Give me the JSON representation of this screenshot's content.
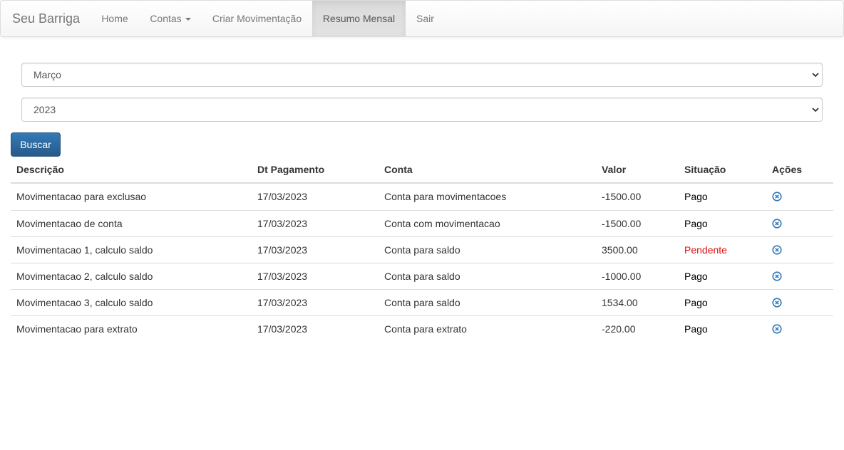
{
  "navbar": {
    "brand": "Seu Barriga",
    "items": [
      {
        "label": "Home"
      },
      {
        "label": "Contas"
      },
      {
        "label": "Criar Movimentação"
      },
      {
        "label": "Resumo Mensal"
      },
      {
        "label": "Sair"
      }
    ],
    "active_item": "Resumo Mensal"
  },
  "filters": {
    "month_selected": "Março",
    "year_selected": "2023",
    "search_label": "Buscar"
  },
  "table": {
    "headers": [
      "Descrição",
      "Dt Pagamento",
      "Conta",
      "Valor",
      "Situação",
      "Ações"
    ],
    "rows": [
      {
        "descricao": "Movimentacao para exclusao",
        "data": "17/03/2023",
        "conta": "Conta para movimentacoes",
        "valor": "-1500.00",
        "situacao": "Pago",
        "icon": "remove-circle-icon"
      },
      {
        "descricao": "Movimentacao de conta",
        "data": "17/03/2023",
        "conta": "Conta com movimentacao",
        "valor": "-1500.00",
        "situacao": "Pago",
        "icon": "remove-circle-icon"
      },
      {
        "descricao": "Movimentacao 1, calculo saldo",
        "data": "17/03/2023",
        "conta": "Conta para saldo",
        "valor": "3500.00",
        "situacao": "Pendente",
        "icon": "remove-circle-icon"
      },
      {
        "descricao": "Movimentacao 2, calculo saldo",
        "data": "17/03/2023",
        "conta": "Conta para saldo",
        "valor": "-1000.00",
        "situacao": "Pago",
        "icon": "remove-circle-icon"
      },
      {
        "descricao": "Movimentacao 3, calculo saldo",
        "data": "17/03/2023",
        "conta": "Conta para saldo",
        "valor": "1534.00",
        "situacao": "Pago",
        "icon": "remove-circle-icon"
      },
      {
        "descricao": "Movimentacao para extrato",
        "data": "17/03/2023",
        "conta": "Conta para extrato",
        "valor": "-220.00",
        "situacao": "Pago",
        "icon": "remove-circle-icon"
      }
    ]
  },
  "colors": {
    "primary_button": "#337ab7",
    "pendente": "#dd1111",
    "link_icon": "#337ab7"
  }
}
